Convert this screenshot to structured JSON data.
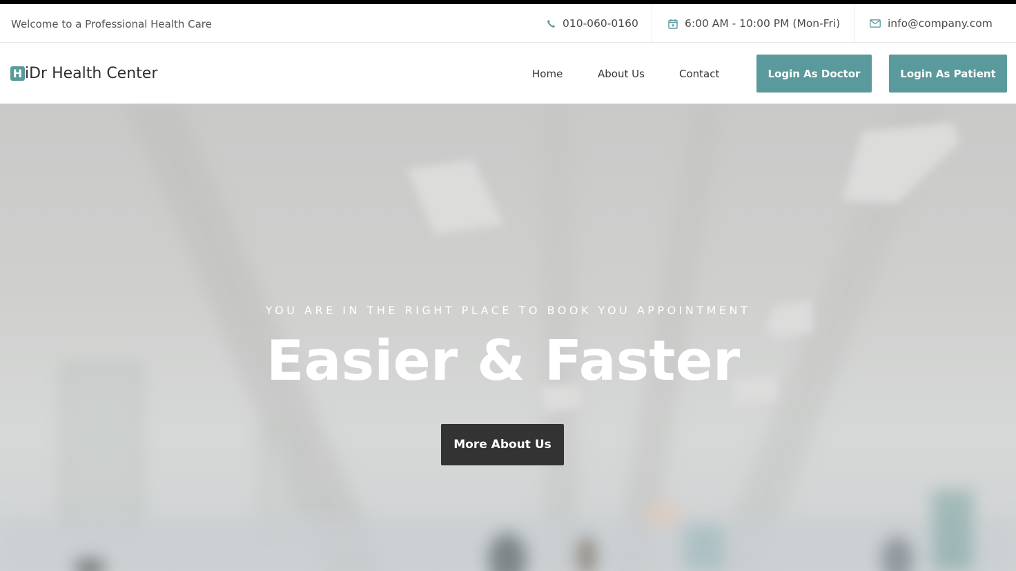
{
  "topbar": {
    "welcome": "Welcome to a Professional Health Care",
    "phone": "010-060-0160",
    "hours": "6:00 AM - 10:00 PM (Mon-Fri)",
    "email": "info@company.com",
    "icons": {
      "phone": "phone-icon",
      "hours": "calendar-icon",
      "email": "envelope-icon"
    }
  },
  "navbar": {
    "brand_mark": "H",
    "brand_text": "iDr Health Center",
    "links": [
      {
        "label": "Home"
      },
      {
        "label": "About Us"
      },
      {
        "label": "Contact"
      }
    ],
    "login_doctor": "Login As Doctor",
    "login_patient": "Login As Patient"
  },
  "hero": {
    "subtitle": "YOU ARE IN THE RIGHT PLACE TO BOOK YOU APPOINTMENT",
    "title": "Easier & Faster",
    "cta": "More About Us"
  },
  "colors": {
    "accent": "#5a9a9c",
    "dark_button": "#333333",
    "text": "#333333"
  }
}
